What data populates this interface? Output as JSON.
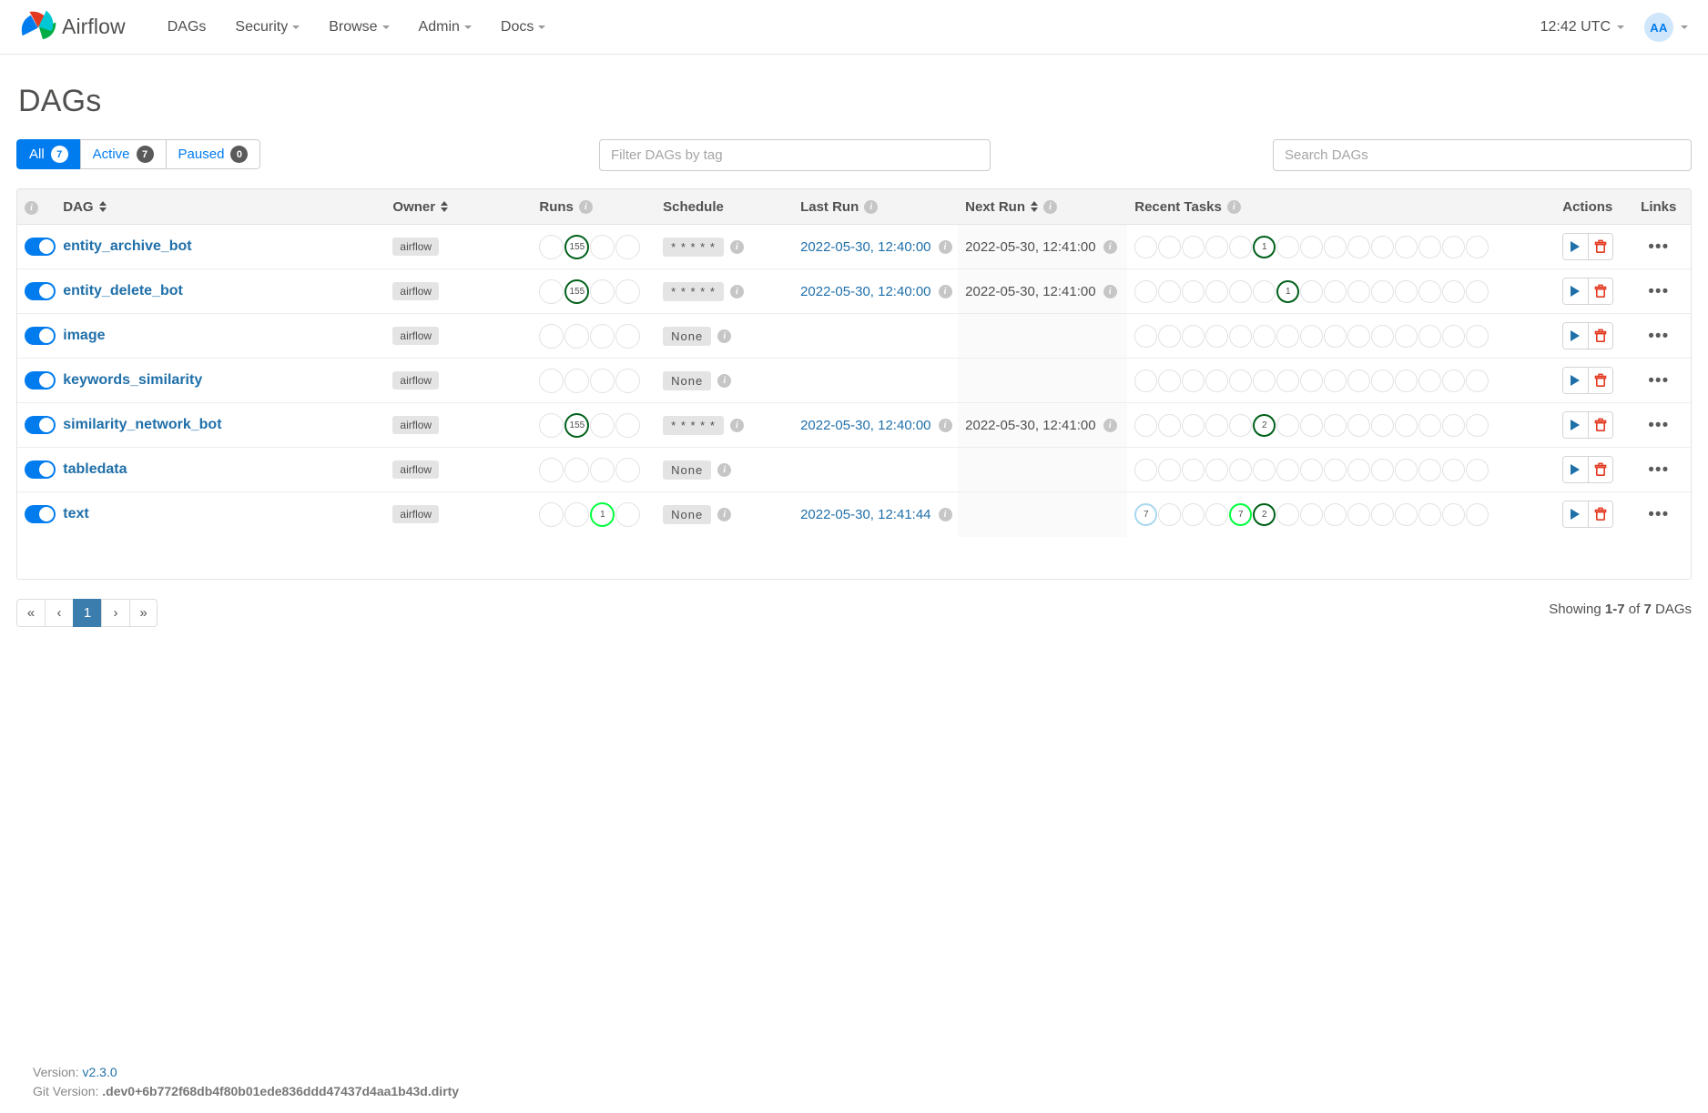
{
  "navbar": {
    "brand": "Airflow",
    "items": [
      {
        "label": "DAGs",
        "caret": false
      },
      {
        "label": "Security",
        "caret": true
      },
      {
        "label": "Browse",
        "caret": true
      },
      {
        "label": "Admin",
        "caret": true
      },
      {
        "label": "Docs",
        "caret": true
      }
    ],
    "clock": "12:42 UTC",
    "avatar_initials": "AA"
  },
  "page": {
    "title": "DAGs"
  },
  "filters": {
    "tabs": [
      {
        "label": "All",
        "count": "7",
        "active": true
      },
      {
        "label": "Active",
        "count": "7",
        "active": false
      },
      {
        "label": "Paused",
        "count": "0",
        "active": false
      }
    ],
    "tag_placeholder": "Filter DAGs by tag",
    "search_placeholder": "Search DAGs"
  },
  "table": {
    "headers": {
      "info": "i",
      "dag": "DAG",
      "owner": "Owner",
      "runs": "Runs",
      "schedule": "Schedule",
      "last_run": "Last Run",
      "next_run": "Next Run",
      "recent_tasks": "Recent Tasks",
      "actions": "Actions",
      "links": "Links"
    },
    "rows": [
      {
        "name": "entity_archive_bot",
        "paused": false,
        "owner": "airflow",
        "runs": [
          {
            "value": "",
            "state": "none"
          },
          {
            "value": "155",
            "state": "success"
          },
          {
            "value": "",
            "state": "none"
          },
          {
            "value": "",
            "state": "none"
          }
        ],
        "schedule": "* * * * *",
        "last_run": "2022-05-30, 12:40:00",
        "next_run": "2022-05-30, 12:41:00",
        "recent_tasks": [
          {
            "value": "",
            "state": "none"
          },
          {
            "value": "",
            "state": "none"
          },
          {
            "value": "",
            "state": "none"
          },
          {
            "value": "",
            "state": "none"
          },
          {
            "value": "",
            "state": "none"
          },
          {
            "value": "1",
            "state": "success"
          },
          {
            "value": "",
            "state": "none"
          },
          {
            "value": "",
            "state": "none"
          },
          {
            "value": "",
            "state": "none"
          },
          {
            "value": "",
            "state": "none"
          },
          {
            "value": "",
            "state": "none"
          },
          {
            "value": "",
            "state": "none"
          },
          {
            "value": "",
            "state": "none"
          },
          {
            "value": "",
            "state": "none"
          },
          {
            "value": "",
            "state": "none"
          }
        ]
      },
      {
        "name": "entity_delete_bot",
        "paused": false,
        "owner": "airflow",
        "runs": [
          {
            "value": "",
            "state": "none"
          },
          {
            "value": "155",
            "state": "success"
          },
          {
            "value": "",
            "state": "none"
          },
          {
            "value": "",
            "state": "none"
          }
        ],
        "schedule": "* * * * *",
        "last_run": "2022-05-30, 12:40:00",
        "next_run": "2022-05-30, 12:41:00",
        "recent_tasks": [
          {
            "value": "",
            "state": "none"
          },
          {
            "value": "",
            "state": "none"
          },
          {
            "value": "",
            "state": "none"
          },
          {
            "value": "",
            "state": "none"
          },
          {
            "value": "",
            "state": "none"
          },
          {
            "value": "",
            "state": "none"
          },
          {
            "value": "1",
            "state": "success"
          },
          {
            "value": "",
            "state": "none"
          },
          {
            "value": "",
            "state": "none"
          },
          {
            "value": "",
            "state": "none"
          },
          {
            "value": "",
            "state": "none"
          },
          {
            "value": "",
            "state": "none"
          },
          {
            "value": "",
            "state": "none"
          },
          {
            "value": "",
            "state": "none"
          },
          {
            "value": "",
            "state": "none"
          }
        ]
      },
      {
        "name": "image",
        "paused": false,
        "owner": "airflow",
        "runs": [
          {
            "value": "",
            "state": "none"
          },
          {
            "value": "",
            "state": "none"
          },
          {
            "value": "",
            "state": "none"
          },
          {
            "value": "",
            "state": "none"
          }
        ],
        "schedule": "None",
        "last_run": "",
        "next_run": "",
        "recent_tasks": [
          {
            "value": "",
            "state": "none"
          },
          {
            "value": "",
            "state": "none"
          },
          {
            "value": "",
            "state": "none"
          },
          {
            "value": "",
            "state": "none"
          },
          {
            "value": "",
            "state": "none"
          },
          {
            "value": "",
            "state": "none"
          },
          {
            "value": "",
            "state": "none"
          },
          {
            "value": "",
            "state": "none"
          },
          {
            "value": "",
            "state": "none"
          },
          {
            "value": "",
            "state": "none"
          },
          {
            "value": "",
            "state": "none"
          },
          {
            "value": "",
            "state": "none"
          },
          {
            "value": "",
            "state": "none"
          },
          {
            "value": "",
            "state": "none"
          },
          {
            "value": "",
            "state": "none"
          }
        ]
      },
      {
        "name": "keywords_similarity",
        "paused": false,
        "owner": "airflow",
        "runs": [
          {
            "value": "",
            "state": "none"
          },
          {
            "value": "",
            "state": "none"
          },
          {
            "value": "",
            "state": "none"
          },
          {
            "value": "",
            "state": "none"
          }
        ],
        "schedule": "None",
        "last_run": "",
        "next_run": "",
        "recent_tasks": [
          {
            "value": "",
            "state": "none"
          },
          {
            "value": "",
            "state": "none"
          },
          {
            "value": "",
            "state": "none"
          },
          {
            "value": "",
            "state": "none"
          },
          {
            "value": "",
            "state": "none"
          },
          {
            "value": "",
            "state": "none"
          },
          {
            "value": "",
            "state": "none"
          },
          {
            "value": "",
            "state": "none"
          },
          {
            "value": "",
            "state": "none"
          },
          {
            "value": "",
            "state": "none"
          },
          {
            "value": "",
            "state": "none"
          },
          {
            "value": "",
            "state": "none"
          },
          {
            "value": "",
            "state": "none"
          },
          {
            "value": "",
            "state": "none"
          },
          {
            "value": "",
            "state": "none"
          }
        ]
      },
      {
        "name": "similarity_network_bot",
        "paused": false,
        "owner": "airflow",
        "runs": [
          {
            "value": "",
            "state": "none"
          },
          {
            "value": "155",
            "state": "success"
          },
          {
            "value": "",
            "state": "none"
          },
          {
            "value": "",
            "state": "none"
          }
        ],
        "schedule": "* * * * *",
        "last_run": "2022-05-30, 12:40:00",
        "next_run": "2022-05-30, 12:41:00",
        "recent_tasks": [
          {
            "value": "",
            "state": "none"
          },
          {
            "value": "",
            "state": "none"
          },
          {
            "value": "",
            "state": "none"
          },
          {
            "value": "",
            "state": "none"
          },
          {
            "value": "",
            "state": "none"
          },
          {
            "value": "2",
            "state": "success"
          },
          {
            "value": "",
            "state": "none"
          },
          {
            "value": "",
            "state": "none"
          },
          {
            "value": "",
            "state": "none"
          },
          {
            "value": "",
            "state": "none"
          },
          {
            "value": "",
            "state": "none"
          },
          {
            "value": "",
            "state": "none"
          },
          {
            "value": "",
            "state": "none"
          },
          {
            "value": "",
            "state": "none"
          },
          {
            "value": "",
            "state": "none"
          }
        ]
      },
      {
        "name": "tabledata",
        "paused": false,
        "owner": "airflow",
        "runs": [
          {
            "value": "",
            "state": "none"
          },
          {
            "value": "",
            "state": "none"
          },
          {
            "value": "",
            "state": "none"
          },
          {
            "value": "",
            "state": "none"
          }
        ],
        "schedule": "None",
        "last_run": "",
        "next_run": "",
        "recent_tasks": [
          {
            "value": "",
            "state": "none"
          },
          {
            "value": "",
            "state": "none"
          },
          {
            "value": "",
            "state": "none"
          },
          {
            "value": "",
            "state": "none"
          },
          {
            "value": "",
            "state": "none"
          },
          {
            "value": "",
            "state": "none"
          },
          {
            "value": "",
            "state": "none"
          },
          {
            "value": "",
            "state": "none"
          },
          {
            "value": "",
            "state": "none"
          },
          {
            "value": "",
            "state": "none"
          },
          {
            "value": "",
            "state": "none"
          },
          {
            "value": "",
            "state": "none"
          },
          {
            "value": "",
            "state": "none"
          },
          {
            "value": "",
            "state": "none"
          },
          {
            "value": "",
            "state": "none"
          }
        ]
      },
      {
        "name": "text",
        "paused": false,
        "owner": "airflow",
        "runs": [
          {
            "value": "",
            "state": "none"
          },
          {
            "value": "",
            "state": "none"
          },
          {
            "value": "1",
            "state": "running"
          },
          {
            "value": "",
            "state": "none"
          }
        ],
        "schedule": "None",
        "last_run": "2022-05-30, 12:41:44",
        "next_run": "",
        "recent_tasks": [
          {
            "value": "7",
            "state": "queued"
          },
          {
            "value": "",
            "state": "none"
          },
          {
            "value": "",
            "state": "none"
          },
          {
            "value": "",
            "state": "none"
          },
          {
            "value": "7",
            "state": "running"
          },
          {
            "value": "2",
            "state": "success"
          },
          {
            "value": "",
            "state": "none"
          },
          {
            "value": "",
            "state": "none"
          },
          {
            "value": "",
            "state": "none"
          },
          {
            "value": "",
            "state": "none"
          },
          {
            "value": "",
            "state": "none"
          },
          {
            "value": "",
            "state": "none"
          },
          {
            "value": "",
            "state": "none"
          },
          {
            "value": "",
            "state": "none"
          },
          {
            "value": "",
            "state": "none"
          }
        ]
      }
    ],
    "links_ellipsis": "•••"
  },
  "pagination": {
    "first": "«",
    "prev": "‹",
    "pages": [
      "1"
    ],
    "next": "›",
    "last": "»",
    "showing_prefix": "Showing ",
    "showing_range": "1-7",
    "showing_middle": " of ",
    "showing_total": "7",
    "showing_suffix": " DAGs"
  },
  "footer": {
    "version_label": "Version: ",
    "version_value": "v2.3.0",
    "git_label": "Git Version: ",
    "git_value": ".dev0+6b772f68db4f80b01ede836ddd47437d4aa1b43d.dirty"
  },
  "colors": {
    "accent": "#017cee",
    "link": "#1f6fa9",
    "success": "#00601a",
    "running": "#01ff3d",
    "queued": "#a9d7f1",
    "delete": "#e43921",
    "page_active": "#3b7dac"
  }
}
